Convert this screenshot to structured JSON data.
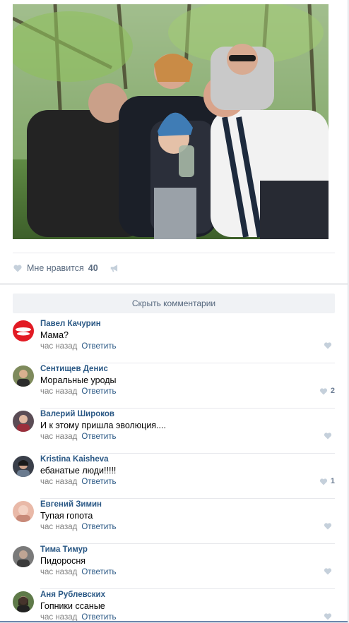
{
  "post": {
    "photo_icon": "photo-image",
    "likes_label": "Мне нравится",
    "likes_count": "40",
    "hide_comments_label": "Скрыть комментарии"
  },
  "colors": {
    "link": "#2a5885",
    "muted": "#828282",
    "heart": "#c5d0db",
    "button_bg": "#f0f2f5"
  },
  "comments": [
    {
      "author": "Павел Качурин",
      "text": "Мама?",
      "time": "час назад",
      "reply": "Ответить",
      "likes": ""
    },
    {
      "author": "Сентищев Денис",
      "text": "Моральные уроды",
      "time": "час назад",
      "reply": "Ответить",
      "likes": "2"
    },
    {
      "author": "Валерий Широков",
      "text": "И к этому пришла эволюция....",
      "time": "час назад",
      "reply": "Ответить",
      "likes": ""
    },
    {
      "author": "Kristina Kaisheva",
      "text": "ебанатые люди!!!!!",
      "time": "час назад",
      "reply": "Ответить",
      "likes": "1"
    },
    {
      "author": "Евгений Зимин",
      "text": "Тупая гопота",
      "time": "час назад",
      "reply": "Ответить",
      "likes": ""
    },
    {
      "author": "Тима Тимур",
      "text": "Пидоросня",
      "time": "час назад",
      "reply": "Ответить",
      "likes": ""
    },
    {
      "author": "Аня Рублевских",
      "text": "Гопники ссаные",
      "time": "час назад",
      "reply": "Ответить",
      "likes": ""
    }
  ]
}
